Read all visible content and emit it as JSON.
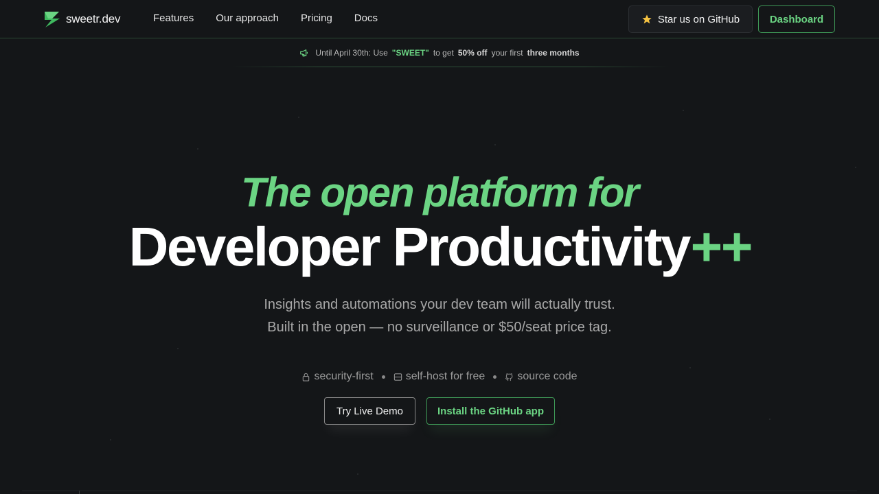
{
  "brand": {
    "name": "sweetr.dev",
    "accent": "#6bd483"
  },
  "nav": {
    "links": [
      "Features",
      "Our approach",
      "Pricing",
      "Docs"
    ],
    "star_label": "Star us on GitHub",
    "dashboard_label": "Dashboard"
  },
  "promo": {
    "prefix": "Until April 30th: Use",
    "code": "\"SWEET\"",
    "middle": "to get",
    "discount": "50% off",
    "middle2": "your first",
    "duration": "three months"
  },
  "hero": {
    "line1": "The open platform for",
    "line2": "Developer Productivity",
    "line2_suffix": "++",
    "sub1": "Insights and automations your dev team will actually trust.",
    "sub2": "Built in the open — no surveillance or $50/seat price tag."
  },
  "features": [
    {
      "icon": "lock-icon",
      "label": "security-first"
    },
    {
      "icon": "server-icon",
      "label": "self-host for free"
    },
    {
      "icon": "github-icon",
      "label": "source code"
    }
  ],
  "cta": {
    "demo_label": "Try Live Demo",
    "install_label": "Install the GitHub app"
  }
}
